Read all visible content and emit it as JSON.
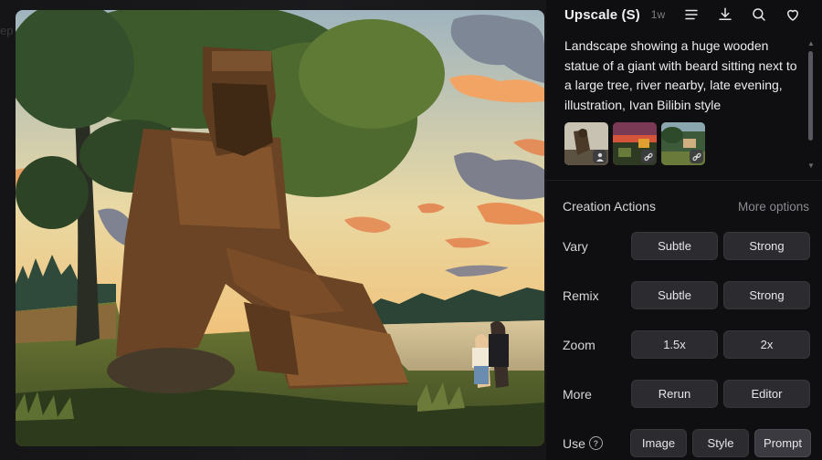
{
  "backdrop": {
    "partial_text": "ep"
  },
  "header": {
    "title": "Upscale (S)",
    "age": "1w",
    "icons": [
      "menu-icon",
      "download-icon",
      "search-icon",
      "heart-icon"
    ]
  },
  "prompt": {
    "text": "Landscape showing a huge wooden statue of a giant with beard sitting next to a large tree, river nearby, late evening, illustration, Ivan Bilibin style"
  },
  "thumbnails": [
    {
      "badge": "person-icon"
    },
    {
      "badge": "link-icon"
    },
    {
      "badge": "link-icon"
    }
  ],
  "actions": {
    "title": "Creation Actions",
    "more_options": "More options",
    "rows": [
      {
        "label": "Vary",
        "buttons": [
          "Subtle",
          "Strong"
        ]
      },
      {
        "label": "Remix",
        "buttons": [
          "Subtle",
          "Strong"
        ]
      },
      {
        "label": "Zoom",
        "buttons": [
          "1.5x",
          "2x"
        ]
      },
      {
        "label": "More",
        "buttons": [
          "Rerun",
          "Editor"
        ]
      },
      {
        "label": "Use",
        "buttons": [
          "Image",
          "Style",
          "Prompt"
        ],
        "active": "Prompt"
      }
    ]
  }
}
